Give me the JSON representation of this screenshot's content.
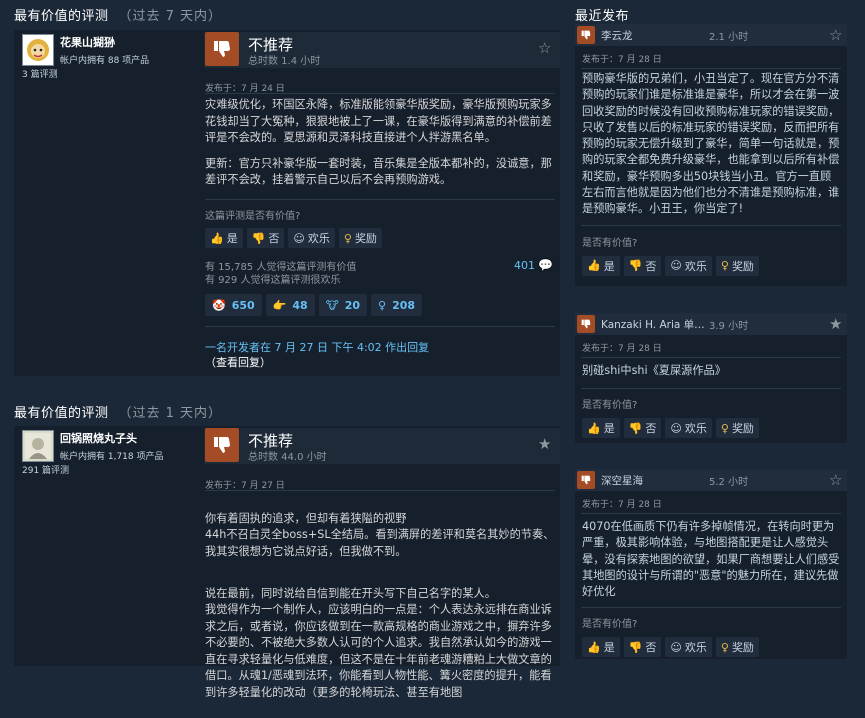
{
  "left": {
    "section1": {
      "title": "最有价值的评测",
      "range": "（过去 7 天内）"
    },
    "review1": {
      "author": "花果山猢狲",
      "products": "帐户内拥有 88 项产品",
      "review_count": "3 篇评测",
      "verdict": "不推荐",
      "hours": "总时数 1.4 小时",
      "posted": "发布于：7 月 24 日",
      "p1": "灾难级优化，环国区永降，标准版能领豪华版奖励，豪华版预购玩家多花钱却当了大冤种，狠狠地被上了一课，在豪华版得到满意的补偿前差评是不会改的。夏思源和灵泽科技直接进个人拌游黑名单。",
      "p2": "更新：官方只补豪华版一套时装，音乐集是全版本都补的，没诚意，那差评不会改，挂着警示自己以后不会再预购游戏。",
      "helpful_q": "这篇评测是否有价值?",
      "btn_yes": "是",
      "btn_no": "否",
      "btn_funny": "欢乐",
      "btn_award": "奖励",
      "helpful_count": "有 15,785 人觉得这篇评测有价值",
      "funny_count": "有 929 人觉得这篇评测很欢乐",
      "comments": "401",
      "awards": [
        "650",
        "48",
        "20",
        "208"
      ],
      "dev_reply": "一名开发者在 7 月 27 日 下午 4:02 作出回复",
      "dev_view": "（查看回复）"
    },
    "section2": {
      "title": "最有价值的评测",
      "range": "（过去 1 天内）"
    },
    "review2": {
      "author": "回锅照烧丸子头",
      "products": "帐户内拥有 1,718 项产品",
      "review_count": "291 篇评测",
      "verdict": "不推荐",
      "hours": "总时数 44.0 小时",
      "posted": "发布于：7 月 27 日",
      "p1": "你有着固执的追求，但却有着狭隘的视野\n44h不召白灵全boss+SL全结局。看到满屏的差评和莫名其妙的节奏、我其实很想为它说点好话，但我做不到。",
      "p2": "说在最前，同时说给自信到能在开头写下自己名字的某人。\n我觉得作为一个制作人，应该明白的一点是：个人表达永远排在商业诉求之后，或者说，你应该做到在一款高规格的商业游戏之中，摒弃许多不必要的、不被绝大多数人认可的个人追求。我自然承认如今的游戏一直在寻求轻量化与低难度，但这不是在十年前老魂游糟粕上大做文章的借口。从魂1/恶魂到法环，你能看到人物性能、篝火密度的提升，能看到许多轻量化的改动（更多的轮椅玩法、甚至有地图"
    }
  },
  "right": {
    "title": "最近发布",
    "helpful_q": "是否有价值?",
    "btn_yes": "是",
    "btn_no": "否",
    "btn_funny": "欢乐",
    "btn_award": "奖励",
    "reviews": [
      {
        "name": "李云龙",
        "hours": "2.1 小时",
        "posted": "发布于：7 月 28 日",
        "body": "预购豪华版的兄弟们，小丑当定了。现在官方分不清预购的玩家们谁是标准谁是豪华，所以才会在第一波回收奖励的时候没有回收预购标准玩家的错误奖励，只收了发售以后的标准玩家的错误奖励，反而把所有预购的玩家无偿升级到了豪华，简单一句话就是，预购的玩家全都免费升级豪华，也能拿到以后所有补偿和奖励，豪华预购多出50块钱当小丑。官方一直顾左右而言他就是因为他们也分不清谁是预购标准，谁是预购豪华。小丑王，你当定了!"
      },
      {
        "name": "Kanzaki H. Aria 单…",
        "hours": "3.9 小时",
        "posted": "发布于：7 月 28 日",
        "body": "别碰shi中shi《夏屎源作品》"
      },
      {
        "name": "深空星海",
        "hours": "5.2 小时",
        "posted": "发布于：7 月 28 日",
        "body": "4070在低画质下仍有许多掉帧情况，在转向时更为严重，极其影响体验，与地图搭配更是让人感觉头晕，没有探索地图的欲望，如果厂商想要让人们感受其地图的设计与所谓的\"恶意\"的魅力所在，建议先做好优化"
      }
    ]
  },
  "colors": {
    "background": "#1b2838",
    "thumb_down": "#a34c25",
    "link": "#66c0f4"
  }
}
